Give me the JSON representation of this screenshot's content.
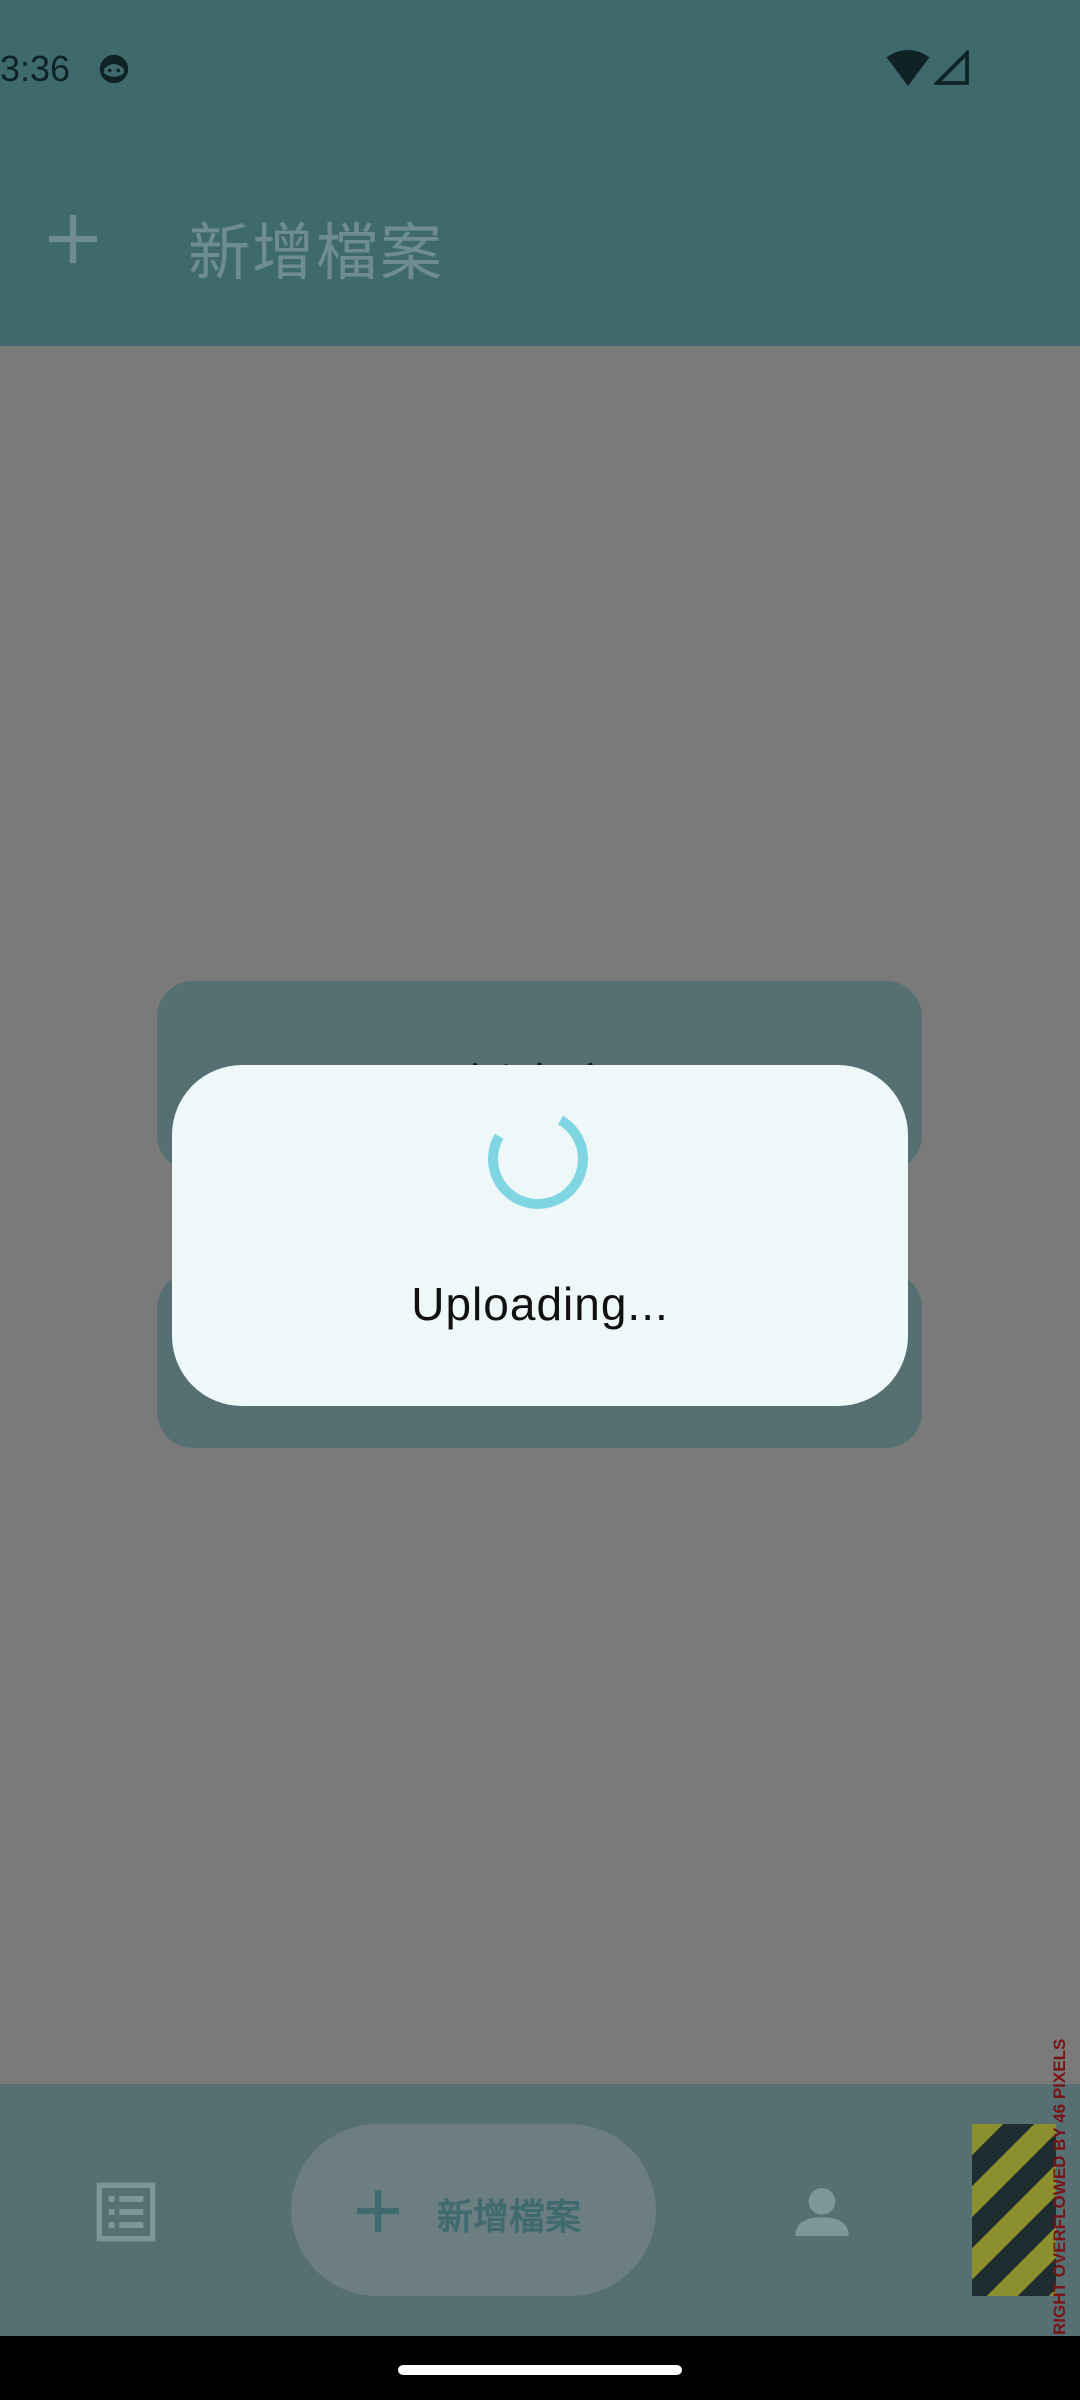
{
  "status_bar": {
    "time": "3:36",
    "icons": [
      "face-icon",
      "wifi-icon",
      "signal-icon"
    ]
  },
  "app_bar": {
    "title": "新增檔案",
    "icon": "add-icon"
  },
  "background_cards": {
    "card1_label": "新專案"
  },
  "dialog": {
    "message": "Uploading...",
    "spinner_icon": "loading-spinner-icon"
  },
  "bottom_nav": {
    "items": [
      {
        "icon": "list-icon"
      },
      {
        "icon": "add-icon",
        "label": "新增檔案"
      },
      {
        "icon": "person-icon"
      }
    ]
  },
  "debug": {
    "overflow_message": "RIGHT OVERFLOWED BY 46 PIXELS"
  },
  "colors": {
    "app_bar": "#3e6a6e",
    "scrim": "#7a7a7a",
    "dialog": "#eef8f9",
    "spinner": "#7fd6e2",
    "accent": "#3f6b70"
  }
}
